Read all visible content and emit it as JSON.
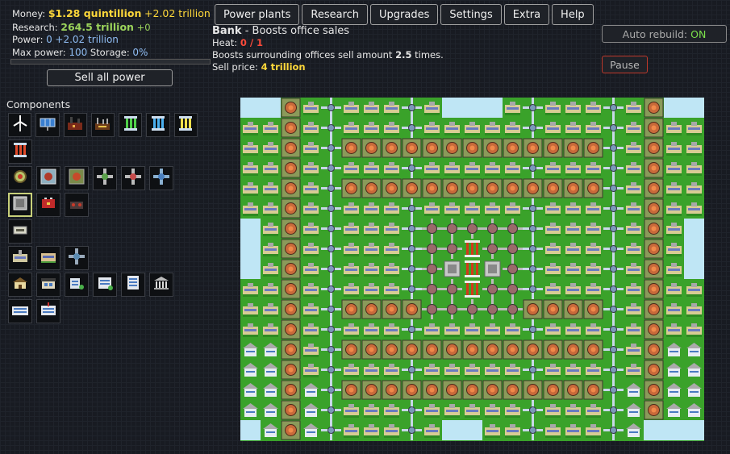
{
  "stats": {
    "money_label": "Money:",
    "money_value": "$1.28 quintillion",
    "money_increase": "+2.02 trillion",
    "research_label": "Research:",
    "research_value": "264.5 trillion",
    "research_increase": "+0",
    "power_label": "Power:",
    "power_value": "0",
    "power_increase": "+2.02 trillion",
    "max_power_label": "Max power:",
    "max_power_value": "100",
    "storage_label": "Storage:",
    "storage_value": "0%"
  },
  "sell_all_label": "Sell all power",
  "nav": [
    "Power plants",
    "Research",
    "Upgrades",
    "Settings",
    "Extra",
    "Help"
  ],
  "info": {
    "name": "Bank",
    "tagline": " - Boosts office sales",
    "heat_label": "Heat: ",
    "heat_value": "0 / 1",
    "description_pre": "Boosts surrounding offices sell amount ",
    "description_value": "2.5",
    "description_post": " times.",
    "sell_label": "Sell price: ",
    "sell_value": "4 trillion"
  },
  "auto_rebuild": {
    "label": "Auto rebuild:",
    "state": "ON"
  },
  "pause_label": "Pause",
  "components_title": "Components",
  "palette_rows": [
    [
      "wind-turbine-icon",
      "solar-panel-icon",
      "coal-plant-icon",
      "factory-icon",
      "green-cell-icon",
      "blue-cell-icon",
      "yellow-cell-icon"
    ],
    [
      "red-cell-icon"
    ],
    [
      "heat-exchanger-icon",
      "cooling-unit-icon",
      "heat-sink-icon",
      "heat-inlet-icon",
      "heat-outlet-icon",
      "heat-pipe-icon"
    ],
    [
      "storage-box-icon",
      "battery-icon",
      "generator-icon"
    ],
    [
      "power-cable-icon"
    ],
    [
      "office-small-icon",
      "office-medium-icon",
      "cross-connector-icon"
    ],
    [
      "house-icon",
      "shop-icon",
      "office-building-icon",
      "apartment-icon",
      "tower-icon",
      "bank-icon"
    ],
    [
      "mall-icon",
      "hospital-icon"
    ]
  ],
  "colors": {
    "money": "#ffd83a",
    "research": "#9bd35b",
    "power": "#8fbcf2",
    "heat": "#ff4a3a",
    "on": "#7be04b",
    "grass": "#3aa22a",
    "water": "#bfe6f5"
  }
}
